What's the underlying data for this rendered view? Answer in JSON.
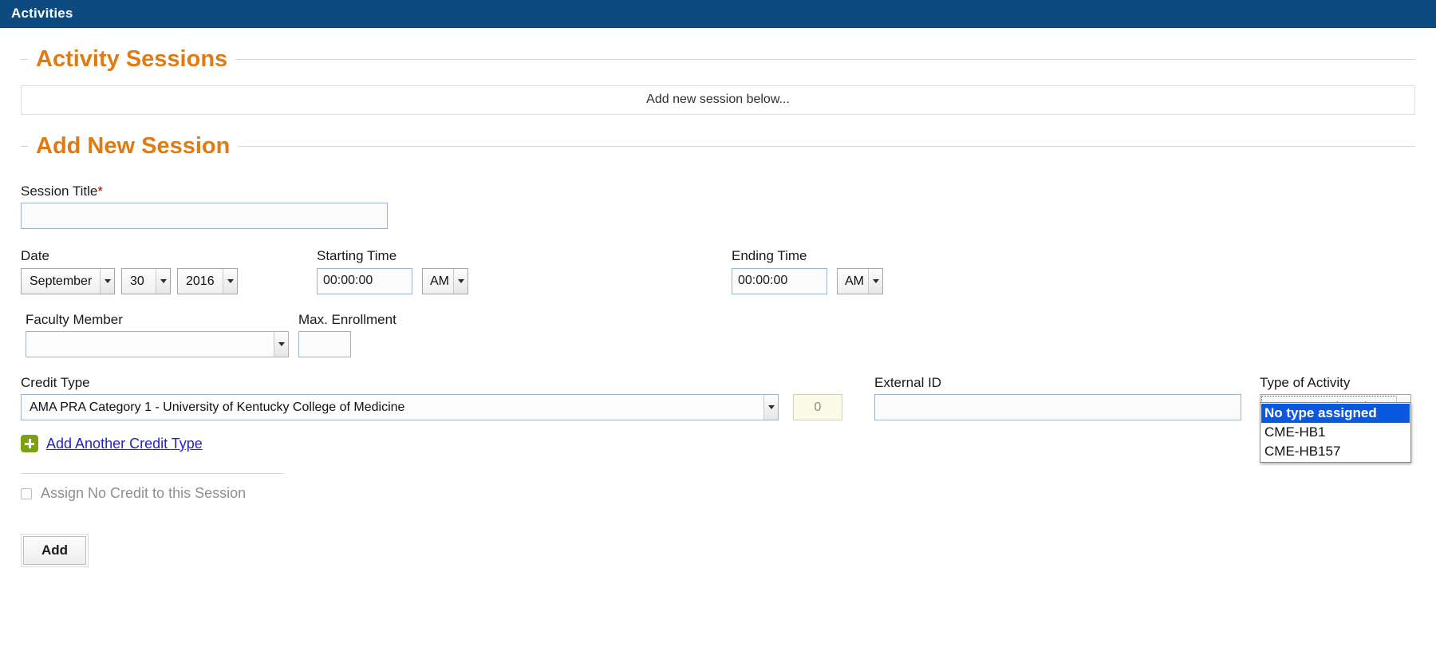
{
  "appbar": {
    "title": "Activities"
  },
  "sections": {
    "activity_sessions": {
      "heading": "Activity Sessions",
      "notice": "Add new session below..."
    },
    "add_new_session": {
      "heading": "Add New Session"
    }
  },
  "form": {
    "session_title": {
      "label": "Session Title",
      "required_mark": "*",
      "value": "",
      "placeholder": ""
    },
    "date": {
      "label": "Date",
      "month": "September",
      "day": "30",
      "year": "2016"
    },
    "starting_time": {
      "label": "Starting Time",
      "value": "00:00:00",
      "meridiem": "AM"
    },
    "ending_time": {
      "label": "Ending Time",
      "value": "00:00:00",
      "meridiem": "AM"
    },
    "faculty_member": {
      "label": "Faculty Member",
      "value": ""
    },
    "max_enrollment": {
      "label": "Max. Enrollment",
      "value": "",
      "placeholder": ""
    },
    "credit_type": {
      "label": "Credit Type",
      "value": "AMA PRA Category 1 - University of Kentucky College of Medicine",
      "amount": "0"
    },
    "external_id": {
      "label": "External ID",
      "value": "",
      "placeholder": ""
    },
    "type_of_activity": {
      "label": "Type of Activity",
      "value": "No type assigned",
      "open": true,
      "options": [
        {
          "label": "No type assigned",
          "selected": true
        },
        {
          "label": "CME-HB1",
          "selected": false
        },
        {
          "label": "CME-HB157",
          "selected": false
        }
      ]
    },
    "add_another_credit_type": {
      "label": "Add Another Credit Type",
      "icon": "plus-icon"
    },
    "assign_no_credit": {
      "label": "Assign No Credit to this Session",
      "checked": false
    },
    "submit": {
      "label": "Add"
    }
  },
  "colors": {
    "appbar_bg": "#0c4a80",
    "heading_orange": "#e07b14",
    "link_blue": "#2222cc",
    "plus_green": "#7ca213",
    "highlight_blue": "#0a58e0",
    "required_red": "#c00000"
  }
}
